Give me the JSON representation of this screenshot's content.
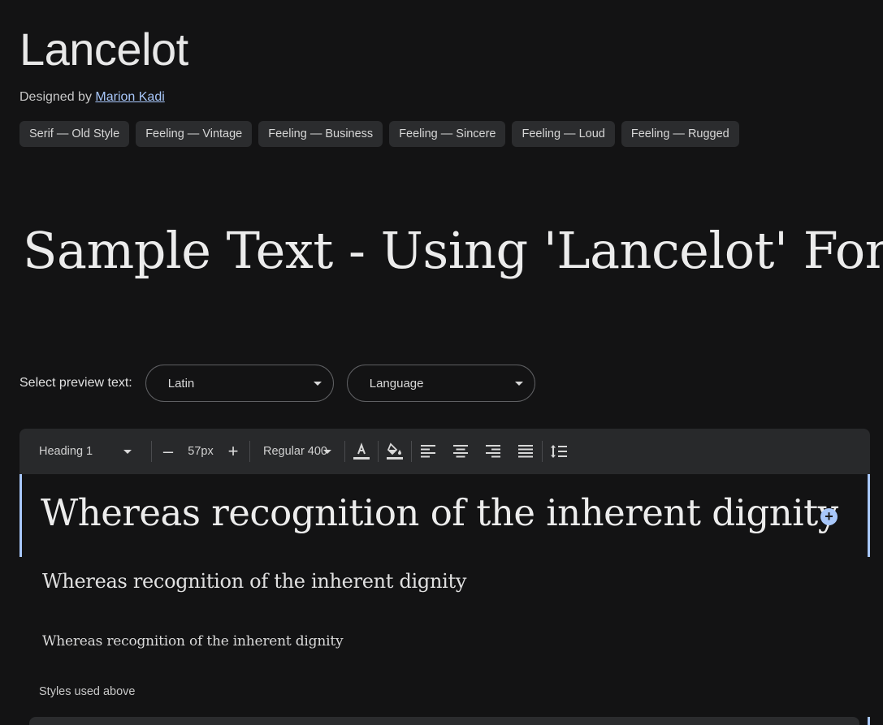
{
  "font": {
    "name": "Lancelot",
    "designed_by_label": "Designed by",
    "designer": "Marion Kadi"
  },
  "tags": [
    "Serif — Old Style",
    "Feeling — Vintage",
    "Feeling — Business",
    "Feeling — Sincere",
    "Feeling — Loud",
    "Feeling — Rugged"
  ],
  "hero_text": "Sample Text - Using 'Lancelot' Font.",
  "preview": {
    "label": "Select preview text:",
    "script_select": "Latin",
    "language_select": "Language"
  },
  "toolbar": {
    "style_select": "Heading 1",
    "decrease_label": "–",
    "size_value": "57px",
    "increase_label": "+",
    "weight_select": "Regular 400",
    "icons": [
      "text-color-icon",
      "highlight-color-icon",
      "align-left-icon",
      "align-center-icon",
      "align-right-icon",
      "align-justify-icon",
      "line-height-icon"
    ]
  },
  "editor": {
    "heading1": "Whereas recognition of the inherent dignity",
    "heading2": "Whereas recognition of the inherent dignity",
    "paragraph": "Whereas recognition of the inherent dignity",
    "add_icon": "+"
  },
  "styles_used_label": "Styles used above",
  "colors": {
    "background": "#131314",
    "accent": "#a8c7fa",
    "chip_bg": "#2b2c2e",
    "toolbar_bg": "#28292b"
  }
}
